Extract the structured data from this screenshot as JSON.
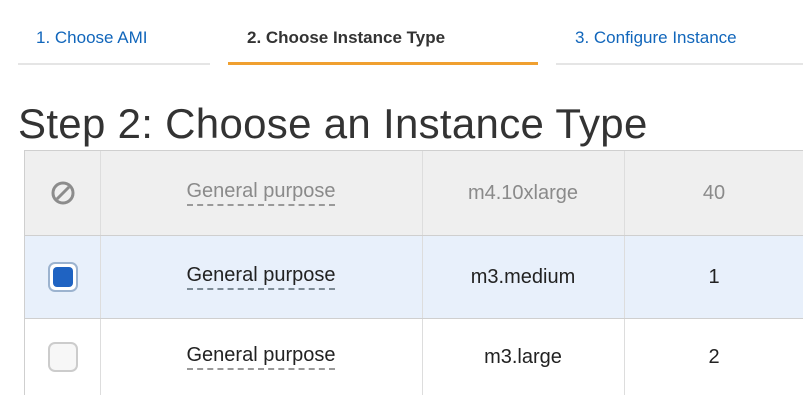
{
  "tabs": [
    {
      "label": "1. Choose AMI",
      "active": false
    },
    {
      "label": "2. Choose Instance Type",
      "active": true
    },
    {
      "label": "3. Configure Instance",
      "active": false
    }
  ],
  "page_title": "Step 2: Choose an Instance Type",
  "rows": [
    {
      "state": "disabled",
      "family": "General purpose",
      "type": "m4.10xlarge",
      "vcpus": "40"
    },
    {
      "state": "selected",
      "family": "General purpose",
      "type": "m3.medium",
      "vcpus": "1"
    },
    {
      "state": "unselected",
      "family": "General purpose",
      "type": "m3.large",
      "vcpus": "2"
    }
  ],
  "icons": {
    "disabled": "no-entry-icon"
  },
  "colors": {
    "tab_active_underline": "#f0a030",
    "tab_link": "#1166bb",
    "selected_row": "#e8f0fb",
    "checkbox_checked": "#1f63c2"
  }
}
